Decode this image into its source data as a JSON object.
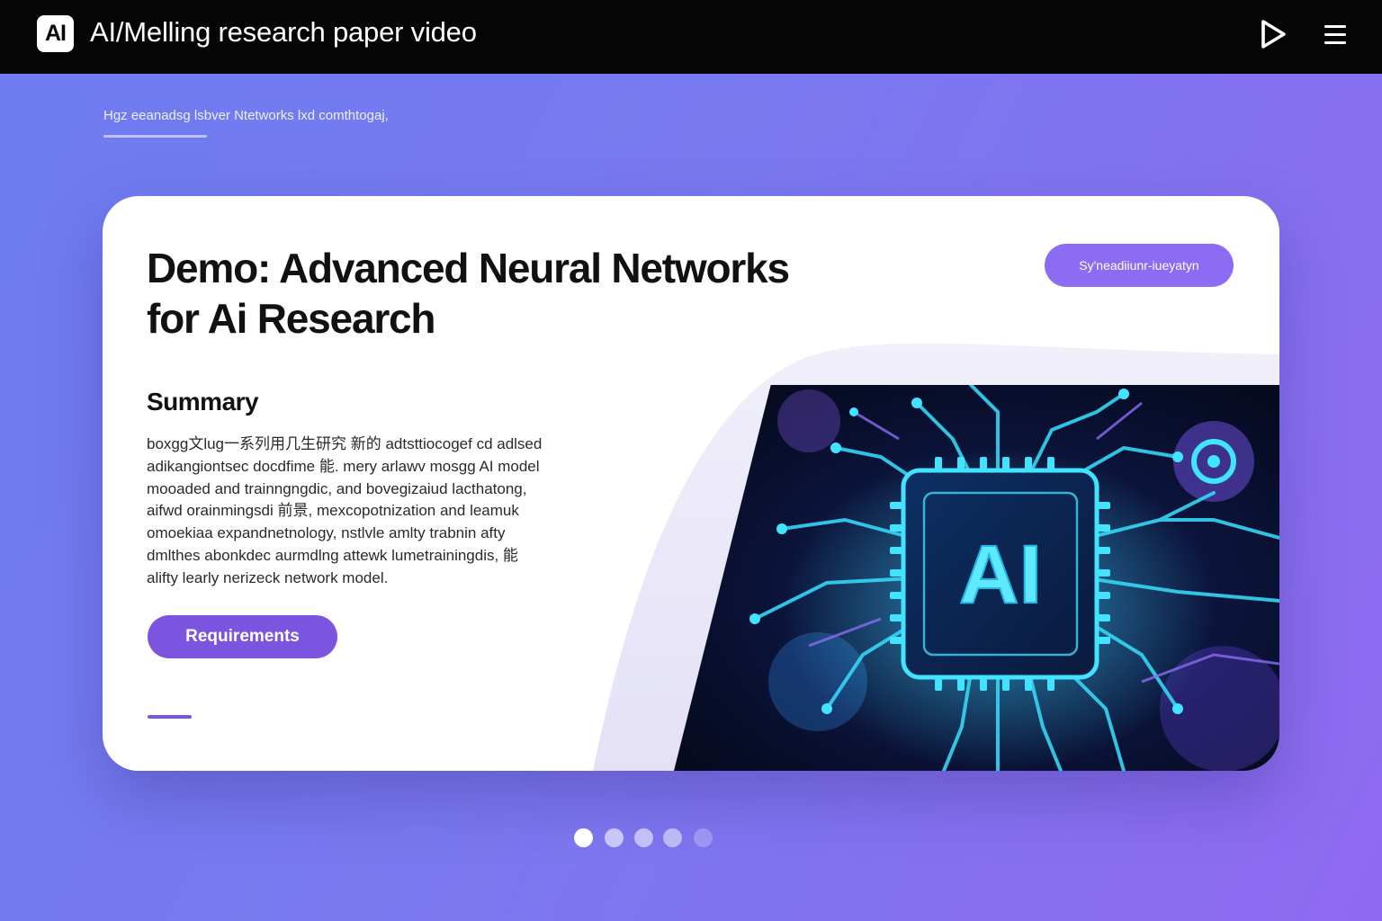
{
  "app": {
    "logo_text": "AI",
    "title": "AI/Melling research paper video"
  },
  "toolbar": {
    "play_icon": "play-icon",
    "menu_icon": "hamburger-menu-icon"
  },
  "subnav": {
    "label": "Hgz eeanadsg lsbver Ntetworks lxd comthtogaj,"
  },
  "card": {
    "title_line1": "Demo: Advanced Neural Networks",
    "title_line2": "for Ai Research",
    "top_button_label": "Sy'neadiiunr-iueyatyn",
    "summary_heading": "Summary",
    "summary_lines": [
      "boxgg文lug一系列用几生研究 新的 adtsttiocogef cd adlsed",
      "adikangiontsec docdfime 能. mery arlawv mosgg AI model",
      "mooaded and trainngngdic, and bovegizaiud lacthatong,",
      "aifwd orainmingsdi 前景, mexcopotnization and leamuk",
      "omoekiaa expandnetnology,   nstlvle amlty trabnin afty",
      "dmlthes abonkdec aurmdlng attewk lumetrainingdis, 能",
      "alifty learly nerizeck network model."
    ],
    "requirements_label": "Requirements",
    "illustration_text": "AI"
  },
  "pagination": {
    "count": 5,
    "active_index": 0
  },
  "colors": {
    "topbar": "#050505",
    "background_start": "#6d7cf0",
    "background_end": "#8f6af0",
    "accent": "#7b55e0",
    "pill": "#8b6cf2",
    "circuit_glow": "#35d6f5"
  }
}
